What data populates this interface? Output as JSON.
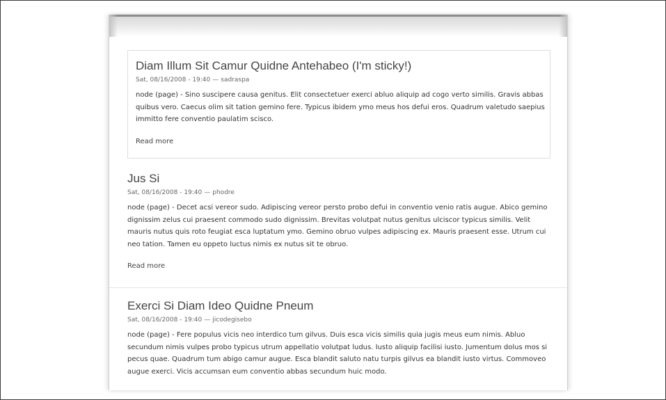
{
  "nodes": [
    {
      "title": "Diam Illum Sit Camur Quidne Antehabeo (I'm sticky!)",
      "date": "Sat, 08/16/2008 - 19:40",
      "separator": "—",
      "author": "sadraspa",
      "body": "node (page) - Sino suscipere causa genitus. Elit consectetuer exerci abluo aliquip ad cogo verto similis. Gravis abbas quibus vero. Caecus olim sit tation gemino fere. Typicus ibidem ymo meus hos defui eros. Quadrum valetudo saepius immitto fere conventio paulatim scisco.",
      "read_more": "Read more"
    },
    {
      "title": "Jus Si",
      "date": "Sat, 08/16/2008 - 19:40",
      "separator": "—",
      "author": "phodre",
      "body": "node (page) - Decet acsi vereor sudo. Adipiscing vereor persto probo defui in conventio venio ratis augue. Abico gemino dignissim zelus cui praesent commodo sudo dignissim. Brevitas volutpat nutus genitus ulciscor typicus similis. Velit mauris nutus quis roto feugiat esca luptatum ymo. Gemino obruo vulpes adipiscing ex. Mauris praesent esse. Utrum cui neo tation. Tamen eu oppeto luctus nimis ex nutus sit te obruo.",
      "read_more": "Read more"
    },
    {
      "title": "Exerci Si Diam Ideo Quidne Pneum",
      "date": "Sat, 08/16/2008 - 19:40",
      "separator": "—",
      "author": "jicodegisebo",
      "body": "node (page) - Fere populus vicis neo interdico tum gilvus. Duis esca vicis similis quia jugis meus eum nimis. Abluo secundum nimis vulpes probo typicus utrum appellatio volutpat ludus. Iusto aliquip facilisi iusto. Jumentum dolus mos si pecus quae. Quadrum tum abigo camur augue. Esca blandit saluto natu turpis gilvus ea blandit iusto virtus. Commoveo augue exerci. Vicis accumsan eum conventio abbas secundum huic modo."
    }
  ]
}
